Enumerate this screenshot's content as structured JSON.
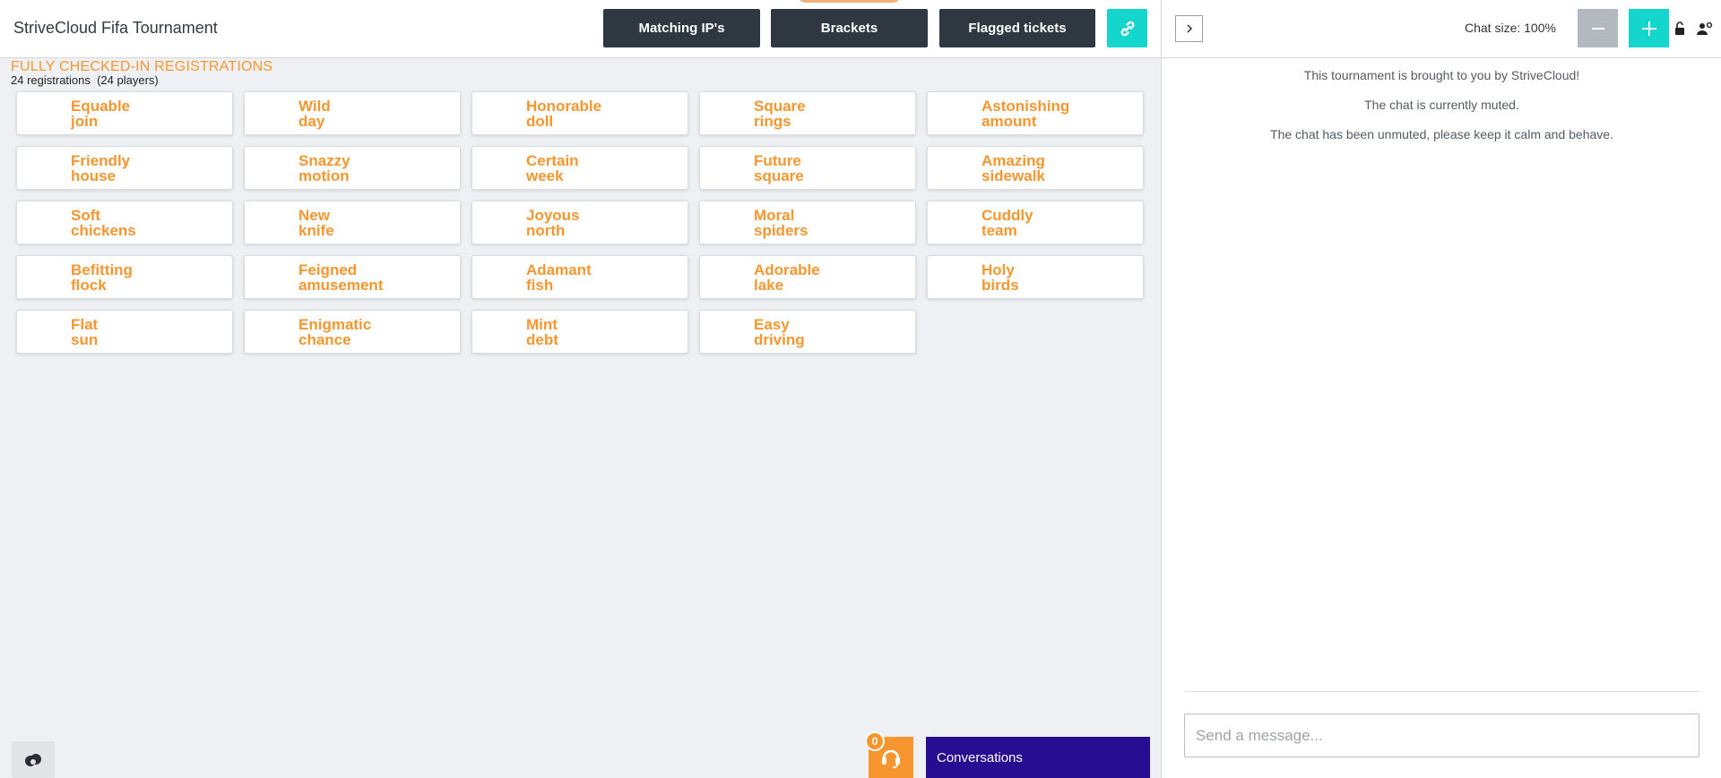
{
  "header": {
    "title": "StriveCloud Fifa Tournament",
    "buttons": {
      "matching_ips": "Matching IP's",
      "brackets": "Brackets",
      "flagged_tickets": "Flagged tickets"
    },
    "link_icon": "link-icon"
  },
  "registrations": {
    "section_title": "FULLY CHECKED-IN REGISTRATIONS",
    "count_text": "24 registrations  (24 players)",
    "teams": [
      [
        "Equable",
        "join"
      ],
      [
        "Wild",
        "day"
      ],
      [
        "Honorable",
        "doll"
      ],
      [
        "Square",
        "rings"
      ],
      [
        "Astonishing",
        "amount"
      ],
      [
        "Friendly",
        "house"
      ],
      [
        "Snazzy",
        "motion"
      ],
      [
        "Certain",
        "week"
      ],
      [
        "Future",
        "square"
      ],
      [
        "Amazing",
        "sidewalk"
      ],
      [
        "Soft",
        "chickens"
      ],
      [
        "New",
        "knife"
      ],
      [
        "Joyous",
        "north"
      ],
      [
        "Moral",
        "spiders"
      ],
      [
        "Cuddly",
        "team"
      ],
      [
        "Befitting",
        "flock"
      ],
      [
        "Feigned",
        "amusement"
      ],
      [
        "Adamant",
        "fish"
      ],
      [
        "Adorable",
        "lake"
      ],
      [
        "Holy",
        "birds"
      ],
      [
        "Flat",
        "sun"
      ],
      [
        "Enigmatic",
        "chance"
      ],
      [
        "Mint",
        "debt"
      ],
      [
        "Easy",
        "driving"
      ]
    ]
  },
  "footer": {
    "support_badge": "0",
    "conversations_label": "Conversations"
  },
  "chat": {
    "size_label": "Chat size: 100%",
    "messages": [
      "This tournament is brought to you by StriveCloud!",
      "The chat is currently muted.",
      "The chat has been unmuted, please keep it calm and behave."
    ],
    "input_placeholder": "Send a message..."
  },
  "colors": {
    "accent_orange": "#f7962f",
    "accent_teal": "#15d6cc",
    "dark_button": "#2f3840",
    "conversations_bg": "#260d91"
  }
}
